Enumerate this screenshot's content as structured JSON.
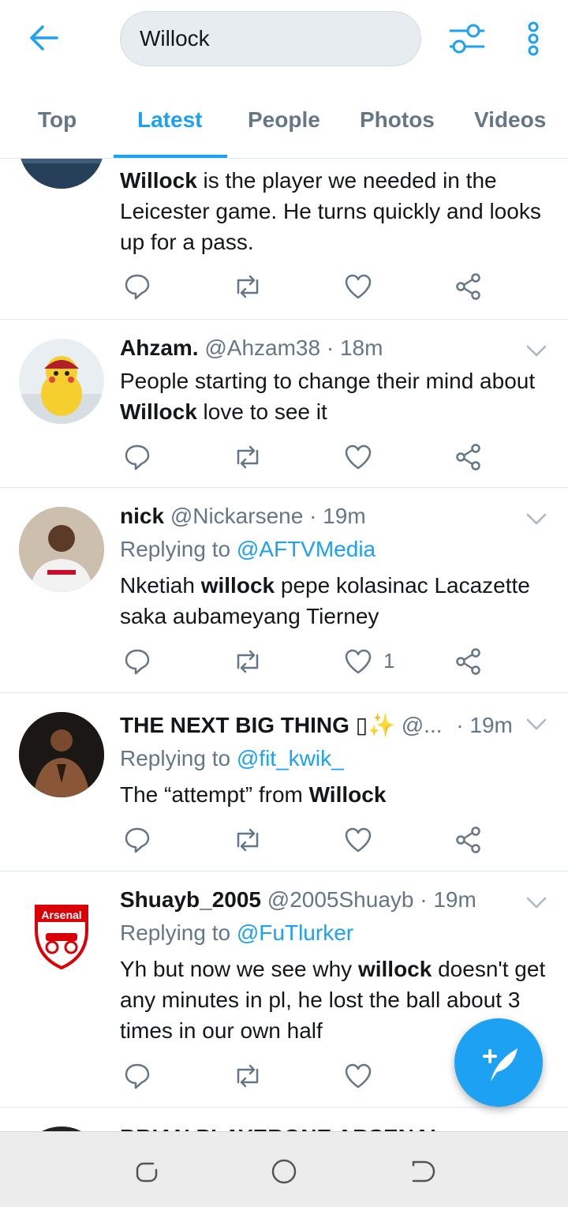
{
  "search": {
    "query": "Willock"
  },
  "tabs": [
    {
      "label": "Top"
    },
    {
      "label": "Latest"
    },
    {
      "label": "People"
    },
    {
      "label": "Photos"
    },
    {
      "label": "Videos"
    }
  ],
  "active_tab": "Latest",
  "tweets": [
    {
      "body_bold": "Willock",
      "body_rest": " is the player we needed in the Leicester game. He turns quickly and looks up for a pass."
    },
    {
      "name": "Ahzam.",
      "handle": "@Ahzam38",
      "time": "· 18m",
      "body_pre": "People starting to change their mind about ",
      "body_bold": "Willock",
      "body_post": " love to see it"
    },
    {
      "name": "nick",
      "handle": "@Nickarsene",
      "time": "· 19m",
      "replying_to_label": "Replying to ",
      "replying_to": "@AFTVMedia",
      "body_pre": "Nketiah ",
      "body_bold": "willock",
      "body_post": " pepe kolasinac Lacazette saka aubameyang Tierney",
      "like_count": "1"
    },
    {
      "name": "THE NEXT BIG THING",
      "name_emoji": "▯✨",
      "handle": "@...",
      "time": "· 19m",
      "replying_to_label": "Replying to ",
      "replying_to": "@fit_kwik_",
      "body_pre": "The “attempt” from ",
      "body_bold": "Willock",
      "body_post": ""
    },
    {
      "name": "Shuayb_2005",
      "handle": "@2005Shuayb",
      "time": "· 19m",
      "replying_to_label": "Replying to ",
      "replying_to": "@FuTlurker",
      "avatar_text": "Arsenal",
      "body_pre": "Yh but now we see why ",
      "body_bold": "willock",
      "body_post": " doesn't get any minutes in pl, he lost the ball about 3 times in our own half"
    },
    {
      "name_partial": "BRIAN PLAYERONE ARSENAL"
    }
  ],
  "colors": {
    "accent": "#1da1f2",
    "muted": "#657786",
    "text": "#14171a",
    "divider": "#e1e8ed"
  }
}
